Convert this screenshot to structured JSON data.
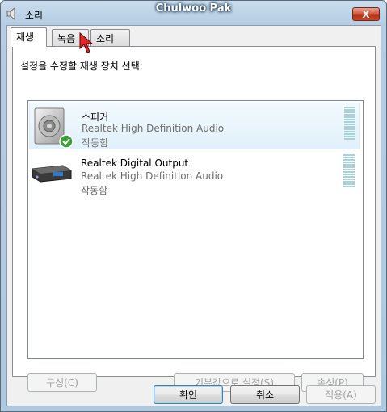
{
  "window": {
    "title": "소리",
    "user": "Chulwoo Pak",
    "close_label": "X"
  },
  "tabs": [
    {
      "label": "재생",
      "active": true
    },
    {
      "label": "녹음",
      "active": false
    },
    {
      "label": "소리",
      "active": false
    }
  ],
  "instruction": "설정을 수정할 재생 장치 선택:",
  "devices": [
    {
      "name": "스피커",
      "driver": "Realtek High Definition Audio",
      "status": "작동함",
      "selected": true,
      "icon": "speaker-icon",
      "default_check": true
    },
    {
      "name": "Realtek Digital Output",
      "driver": "Realtek High Definition Audio",
      "status": "작동함",
      "selected": false,
      "icon": "digital-output-icon",
      "default_check": false
    }
  ],
  "panel_buttons": {
    "configure": "구성(C)",
    "set_default": "기본값으로 설정(S)",
    "properties": "속성(P)"
  },
  "dialog_buttons": {
    "ok": "확인",
    "cancel": "취소",
    "apply": "적용(A)"
  },
  "colors": {
    "titlebar": "#b5cde3",
    "close": "#c8482a",
    "selection": "#e1f0fa",
    "meter": "#a9d2d8"
  }
}
